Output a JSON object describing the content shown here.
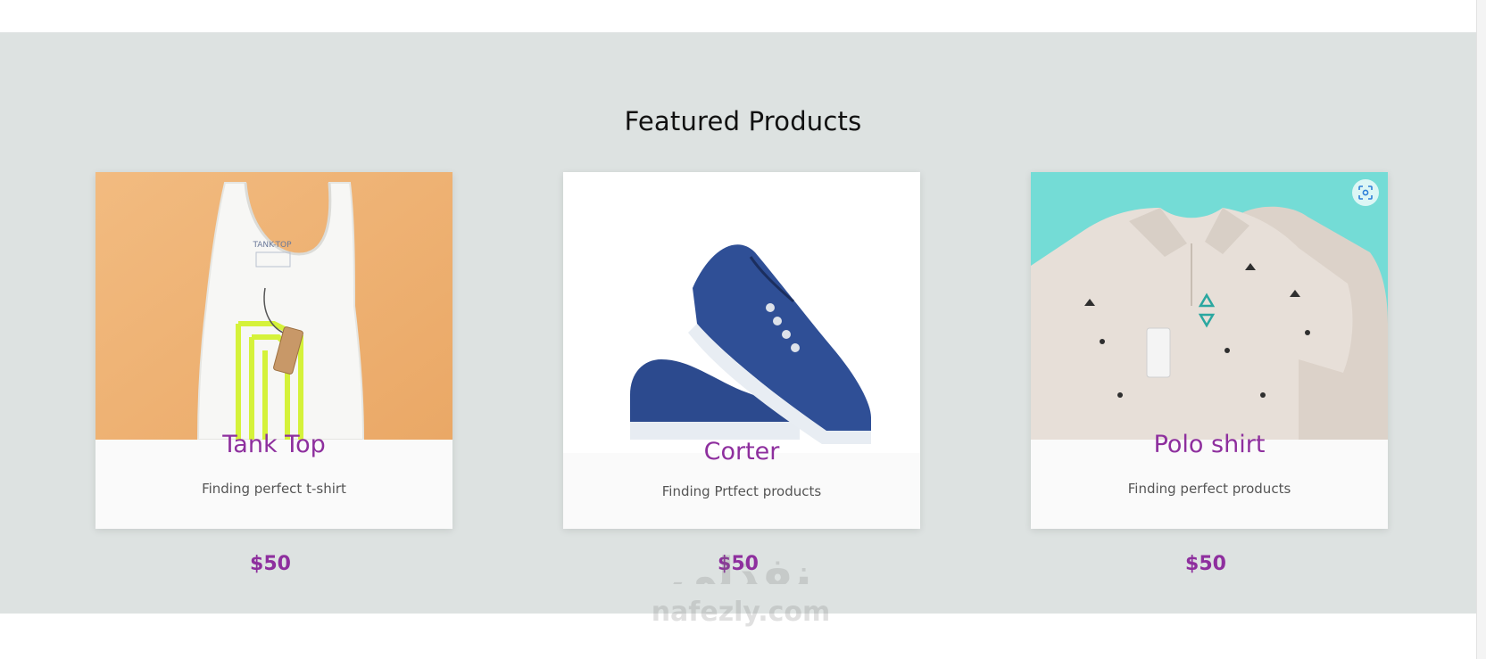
{
  "section": {
    "title": "Featured Products"
  },
  "products": [
    {
      "image_icon": "tank-top-image",
      "image_bg": "#f0b57a",
      "title": "Tank Top",
      "description": "Finding perfect t-shirt",
      "price": "$50"
    },
    {
      "image_icon": "sneakers-image",
      "image_bg": "#ffffff",
      "title": "Corter",
      "description": "Finding Prtfect products",
      "price": "$50"
    },
    {
      "image_icon": "polo-shirt-image",
      "image_bg": "#74dcd6",
      "title": "Polo shirt",
      "description": "Finding perfect products",
      "price": "$50"
    }
  ],
  "overlay": {
    "lens_icon": "visual-search-icon"
  },
  "watermark": {
    "arabic": "نفذلي",
    "latin": "nafezly.com"
  },
  "colors": {
    "section_bg": "#dde2e1",
    "accent": "#8e2f9e",
    "card_bg": "#fafafa"
  }
}
